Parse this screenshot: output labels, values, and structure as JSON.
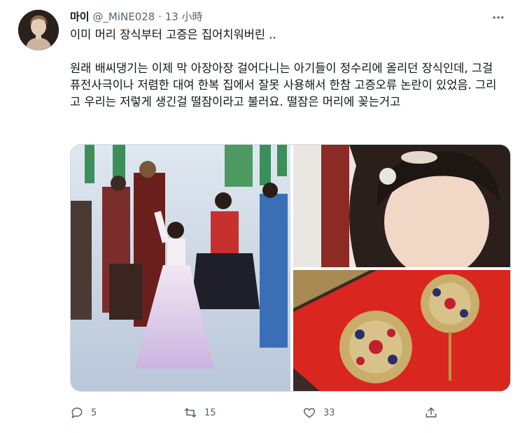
{
  "tweet": {
    "display_name": "마이",
    "handle": "@_MiNE028",
    "separator": "·",
    "time": "13 小時",
    "text": "이미 머리 장식부터 고증은 집어치워버린 ..\n\n원래 배씨댕기는 이제 막 아장아장 걸어다니는 아기들이 정수리에 올리던 장식인데, 그걸 퓨전사극이나 저렴한 대여 한복 집에서 잘못 사용해서 한참 고증오류 논란이 있었음. 그리고 우리는 저렇게 생긴걸 떨잠이라고 불러요. 떨잠은 머리에 꽂는거고"
  },
  "actions": {
    "reply_count": "5",
    "retweet_count": "15",
    "like_count": "33"
  },
  "icons": {
    "more": "more-icon",
    "reply": "reply-icon",
    "retweet": "retweet-icon",
    "like": "heart-icon",
    "share": "share-icon"
  },
  "colors": {
    "text": "#0f1419",
    "secondary": "#536471",
    "border": "#cfd9de"
  }
}
